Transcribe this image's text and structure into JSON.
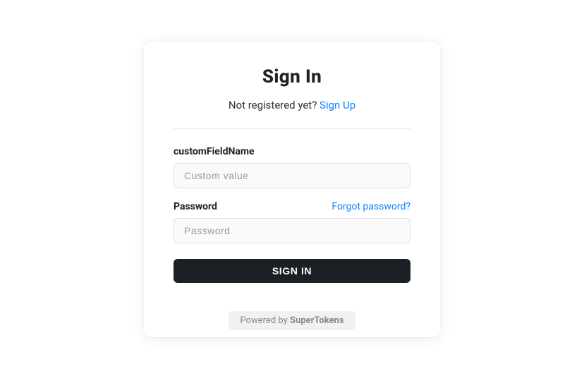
{
  "header": {
    "title": "Sign In",
    "subtitle_text": "Not registered yet? ",
    "signup_link": "Sign Up"
  },
  "fields": {
    "custom": {
      "label": "customFieldName",
      "placeholder": "Custom value"
    },
    "password": {
      "label": "Password",
      "placeholder": "Password",
      "forgot_link": "Forgot password?"
    }
  },
  "submit_label": "SIGN IN",
  "footer": {
    "powered_by": "Powered by ",
    "brand": "SuperTokens"
  }
}
